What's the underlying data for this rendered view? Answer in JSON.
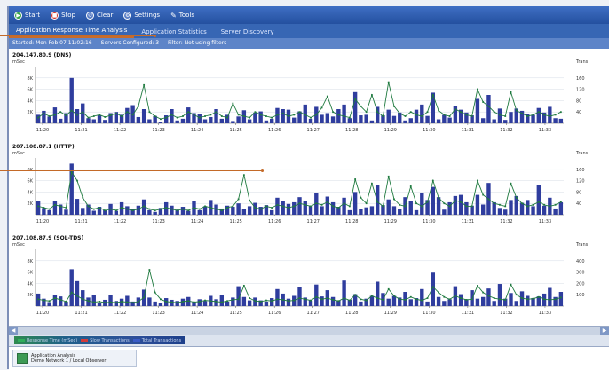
{
  "toolbar": {
    "start": "Start",
    "stop": "Stop",
    "clear": "Clear",
    "settings": "Settings",
    "tools": "Tools"
  },
  "tabs": [
    {
      "label": "Application Response Time Analysis",
      "active": true
    },
    {
      "label": "Application Statistics",
      "active": false
    },
    {
      "label": "Server Discovery",
      "active": false
    }
  ],
  "status": {
    "started": "Started: Mon Feb 07 11:02:16",
    "servers": "Servers Configured: 3",
    "filter": "Filter: Not using filters"
  },
  "chart_data": [
    {
      "type": "bar",
      "title": "204.147.80.9 (DNS)",
      "ylabel": "mSec",
      "y2label": "Trans",
      "yticks": [
        "8K",
        "6K",
        "4K",
        "2K"
      ],
      "y2ticks": [
        "160",
        "120",
        "80",
        "40"
      ],
      "ylim": [
        0,
        10000
      ],
      "y2lim": [
        0,
        200
      ],
      "categories": [
        "11:20",
        "11:21",
        "11:22",
        "11:23",
        "11:24",
        "11:25",
        "11:26",
        "11:27",
        "11:28",
        "11:29",
        "11:30",
        "11:31",
        "11:32",
        "11:33"
      ],
      "series": [
        {
          "kind": "bar",
          "color": "#2f3d9e",
          "values": [
            1500,
            2200,
            1200,
            2800,
            800,
            1800,
            8000,
            2500,
            3500,
            900,
            700,
            1400,
            600,
            1800,
            2000,
            1500,
            2700,
            3200,
            1100,
            2500,
            700,
            1300,
            300,
            1400,
            2500,
            500,
            800,
            2800,
            1800,
            1600,
            700,
            1100,
            2500,
            800,
            1500,
            400,
            1200,
            2300,
            700,
            1900,
            2100,
            500,
            800,
            2700,
            2500,
            2400,
            1000,
            2100,
            3300,
            800,
            2900,
            1500,
            1800,
            1200,
            2500,
            3300,
            900,
            5500,
            1400,
            1500,
            500,
            2900,
            1400,
            2400,
            1300,
            1900,
            500,
            900,
            2400,
            3300,
            1300,
            5400,
            700,
            1500,
            1000,
            3000,
            2400,
            1900,
            1400,
            4300,
            900,
            5000,
            700,
            2600,
            600,
            2000,
            2600,
            2200,
            1600,
            1500,
            2700,
            1900,
            2900,
            900,
            800
          ]
        },
        {
          "kind": "line",
          "color": "#1f7a3f",
          "values": [
            20,
            35,
            25,
            30,
            40,
            28,
            45,
            30,
            40,
            20,
            25,
            30,
            22,
            28,
            35,
            25,
            40,
            30,
            60,
            135,
            40,
            25,
            15,
            20,
            30,
            20,
            25,
            40,
            30,
            20,
            25,
            30,
            40,
            25,
            20,
            70,
            30,
            25,
            20,
            40,
            30,
            25,
            20,
            30,
            35,
            25,
            30,
            40,
            30,
            20,
            30,
            55,
            95,
            40,
            30,
            25,
            20,
            85,
            60,
            40,
            100,
            40,
            25,
            145,
            60,
            35,
            25,
            40,
            30,
            25,
            40,
            100,
            45,
            30,
            25,
            50,
            40,
            30,
            25,
            120,
            75,
            60,
            40,
            30,
            25,
            110,
            45,
            35,
            25,
            30,
            40,
            30,
            25,
            30,
            40
          ]
        }
      ]
    },
    {
      "type": "bar",
      "title": "207.108.87.1 (HTTP)",
      "ylabel": "mSec",
      "y2label": "Trans",
      "yticks": [
        "8K",
        "6K",
        "4K",
        "2K"
      ],
      "y2ticks": [
        "160",
        "120",
        "80",
        "40"
      ],
      "ylim": [
        0,
        10000
      ],
      "y2lim": [
        0,
        200
      ],
      "categories": [
        "11:20",
        "11:21",
        "11:22",
        "11:23",
        "11:24",
        "11:25",
        "11:26",
        "11:27",
        "11:28",
        "11:29",
        "11:30",
        "11:31",
        "11:32",
        "11:33"
      ],
      "series": [
        {
          "kind": "bar",
          "color": "#2f3d9e",
          "values": [
            2500,
            1200,
            800,
            2500,
            1800,
            900,
            9000,
            2800,
            1200,
            1800,
            700,
            1400,
            800,
            1900,
            700,
            2200,
            1500,
            1000,
            1600,
            2700,
            800,
            500,
            1200,
            2200,
            1600,
            900,
            1400,
            700,
            2500,
            800,
            1500,
            2600,
            1800,
            1100,
            1600,
            1400,
            2000,
            1000,
            1500,
            2100,
            1400,
            1700,
            800,
            3000,
            2400,
            1900,
            2200,
            3100,
            2500,
            1600,
            3900,
            1500,
            3200,
            2200,
            1400,
            3000,
            800,
            4000,
            1000,
            1300,
            1500,
            5200,
            1700,
            2700,
            1500,
            1000,
            3100,
            2400,
            800,
            3800,
            2600,
            4900,
            3100,
            900,
            2200,
            3300,
            3500,
            2200,
            1600,
            3500,
            1800,
            5600,
            2200,
            1200,
            900,
            2600,
            3300,
            2100,
            2600,
            1500,
            5200,
            1600,
            3000,
            1100,
            2200
          ]
        },
        {
          "kind": "line",
          "color": "#1f7a3f",
          "values": [
            30,
            25,
            20,
            35,
            30,
            25,
            150,
            120,
            60,
            30,
            20,
            25,
            15,
            20,
            15,
            25,
            20,
            15,
            20,
            30,
            20,
            15,
            20,
            25,
            20,
            15,
            20,
            15,
            25,
            20,
            30,
            25,
            20,
            15,
            25,
            30,
            55,
            140,
            50,
            25,
            20,
            30,
            25,
            35,
            30,
            25,
            30,
            40,
            35,
            30,
            40,
            35,
            45,
            30,
            25,
            40,
            30,
            125,
            60,
            40,
            110,
            45,
            30,
            135,
            55,
            35,
            30,
            100,
            40,
            30,
            45,
            120,
            60,
            40,
            30,
            50,
            45,
            30,
            30,
            120,
            70,
            55,
            40,
            35,
            30,
            110,
            60,
            40,
            30,
            35,
            45,
            35,
            30,
            35,
            45
          ]
        }
      ]
    },
    {
      "type": "bar",
      "title": "207.108.87.9 (SQL-TDS)",
      "ylabel": "mSec",
      "y2label": "Trans",
      "yticks": [
        "8K",
        "6K",
        "4K",
        "2K"
      ],
      "y2ticks": [
        "400",
        "300",
        "200",
        "100"
      ],
      "ylim": [
        0,
        10000
      ],
      "y2lim": [
        0,
        500
      ],
      "categories": [
        "11:20",
        "11:21",
        "11:22",
        "11:23",
        "11:24",
        "11:25",
        "11:26",
        "11:27",
        "11:28",
        "11:29",
        "11:30",
        "11:31",
        "11:32",
        "11:33"
      ],
      "series": [
        {
          "kind": "bar",
          "color": "#2f3d9e",
          "values": [
            2200,
            1300,
            700,
            2000,
            1700,
            800,
            6500,
            4400,
            2800,
            1500,
            1900,
            600,
            1100,
            2000,
            900,
            1300,
            1800,
            800,
            1500,
            2900,
            1500,
            800,
            600,
            1400,
            1100,
            900,
            1300,
            1600,
            700,
            1200,
            900,
            1800,
            1200,
            1900,
            800,
            1500,
            3500,
            1600,
            1000,
            1500,
            1000,
            800,
            1400,
            3000,
            2200,
            1300,
            1800,
            3300,
            1500,
            1000,
            3800,
            1700,
            2800,
            1600,
            1000,
            4500,
            1100,
            2100,
            800,
            1300,
            1800,
            4300,
            2300,
            1300,
            1800,
            1500,
            2500,
            1200,
            1400,
            3000,
            800,
            5900,
            1600,
            900,
            1200,
            3500,
            2100,
            1200,
            2800,
            1300,
            1600,
            3100,
            900,
            3900,
            1300,
            2300,
            900,
            2600,
            1800,
            1400,
            1700,
            2200,
            3200,
            1600,
            2500
          ]
        },
        {
          "kind": "line",
          "color": "#1f7a3f",
          "values": [
            60,
            50,
            45,
            70,
            55,
            40,
            120,
            90,
            60,
            45,
            35,
            40,
            30,
            35,
            30,
            40,
            35,
            30,
            40,
            75,
            320,
            120,
            60,
            40,
            35,
            30,
            40,
            45,
            35,
            40,
            50,
            45,
            40,
            35,
            45,
            55,
            60,
            180,
            70,
            45,
            40,
            50,
            45,
            60,
            55,
            45,
            50,
            70,
            60,
            50,
            80,
            60,
            70,
            55,
            45,
            70,
            50,
            100,
            60,
            50,
            90,
            70,
            55,
            150,
            90,
            60,
            55,
            80,
            60,
            50,
            70,
            170,
            120,
            80,
            60,
            90,
            70,
            55,
            60,
            180,
            120,
            90,
            70,
            60,
            55,
            190,
            100,
            70,
            60,
            65,
            80,
            60,
            55,
            60,
            75
          ]
        }
      ]
    }
  ],
  "legend": [
    {
      "label": "Response Time (mSec)",
      "color": "#2fae5a"
    },
    {
      "label": "Slow Transactions",
      "color": "#d23b3b"
    },
    {
      "label": "Total Transactions",
      "color": "#3a5cc7"
    }
  ],
  "footer": {
    "line1": "Application Analysis",
    "line2": "Demo Network 1 / Local Observer"
  }
}
